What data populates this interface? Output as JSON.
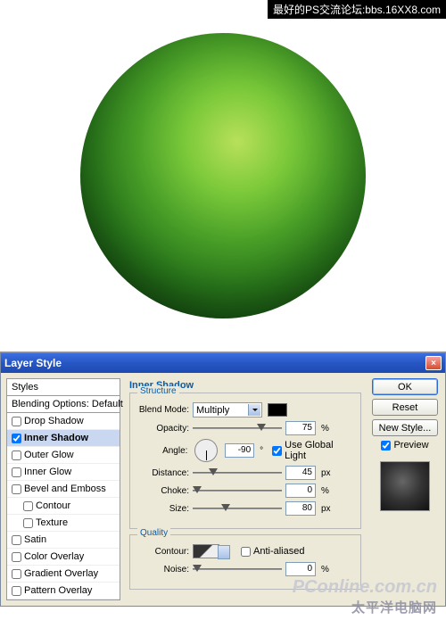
{
  "banner": "最好的PS交流论坛:bbs.16XX8.com",
  "dialog": {
    "title": "Layer Style"
  },
  "sidebar": {
    "styles": "Styles",
    "blending": "Blending Options: Default",
    "items": [
      {
        "label": "Drop Shadow",
        "checked": false,
        "sel": false
      },
      {
        "label": "Inner Shadow",
        "checked": true,
        "sel": true
      },
      {
        "label": "Outer Glow",
        "checked": false,
        "sel": false
      },
      {
        "label": "Inner Glow",
        "checked": false,
        "sel": false
      },
      {
        "label": "Bevel and Emboss",
        "checked": false,
        "sel": false
      },
      {
        "label": "Contour",
        "checked": false,
        "sel": false,
        "indent": true
      },
      {
        "label": "Texture",
        "checked": false,
        "sel": false,
        "indent": true
      },
      {
        "label": "Satin",
        "checked": false,
        "sel": false
      },
      {
        "label": "Color Overlay",
        "checked": false,
        "sel": false
      },
      {
        "label": "Gradient Overlay",
        "checked": false,
        "sel": false
      },
      {
        "label": "Pattern Overlay",
        "checked": false,
        "sel": false
      }
    ]
  },
  "panel": {
    "title": "Inner Shadow",
    "structure": {
      "legend": "Structure",
      "blendmode_label": "Blend Mode:",
      "blendmode_value": "Multiply",
      "opacity_label": "Opacity:",
      "opacity_value": "75",
      "opacity_unit": "%",
      "angle_label": "Angle:",
      "angle_value": "-90",
      "angle_unit": "°",
      "use_global": "Use Global Light",
      "use_global_checked": true,
      "distance_label": "Distance:",
      "distance_value": "45",
      "distance_unit": "px",
      "choke_label": "Choke:",
      "choke_value": "0",
      "choke_unit": "%",
      "size_label": "Size:",
      "size_value": "80",
      "size_unit": "px"
    },
    "quality": {
      "legend": "Quality",
      "contour_label": "Contour:",
      "antialiased": "Anti-aliased",
      "antialiased_checked": false,
      "noise_label": "Noise:",
      "noise_value": "0",
      "noise_unit": "%"
    }
  },
  "buttons": {
    "ok": "OK",
    "reset": "Reset",
    "newstyle": "New Style...",
    "preview": "Preview",
    "preview_checked": true
  },
  "watermark": {
    "l1": "PConline.com.cn",
    "l2": "太平洋电脑网"
  }
}
